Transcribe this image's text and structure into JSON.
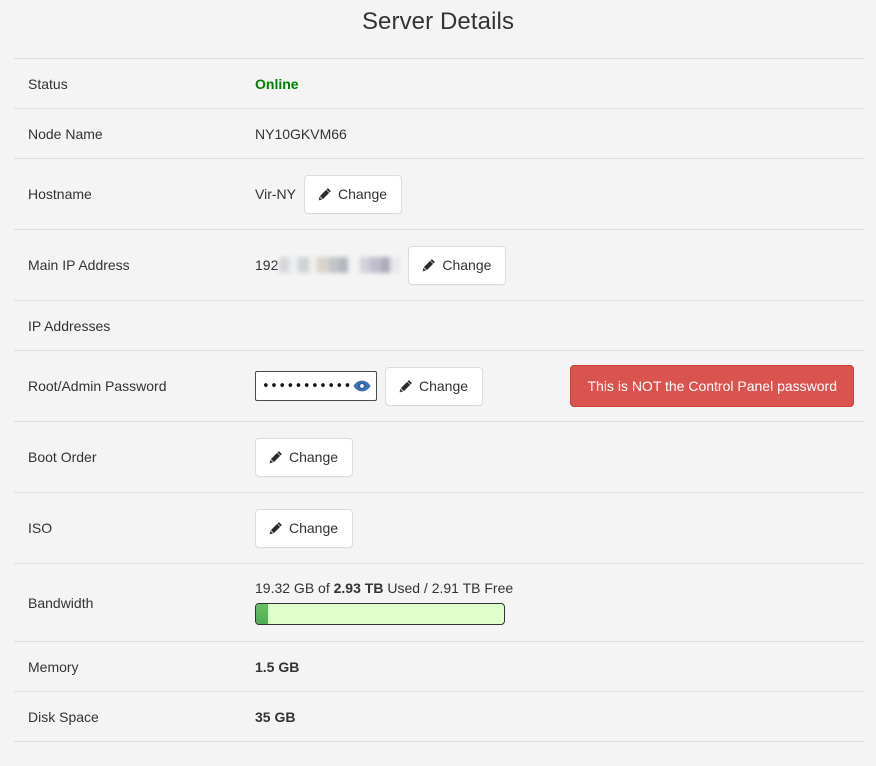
{
  "page": {
    "title": "Server Details",
    "background_color": "#f4f4f4",
    "divider_color": "#dedede"
  },
  "rows": {
    "status": {
      "label": "Status",
      "value": "Online",
      "value_color": "#008000"
    },
    "node_name": {
      "label": "Node Name",
      "value": "NY10GKVM66"
    },
    "hostname": {
      "label": "Hostname",
      "value": "Vir-NY",
      "button_label": "Change"
    },
    "main_ip": {
      "label": "Main IP Address",
      "value_prefix": "192",
      "value_redacted": true,
      "button_label": "Change"
    },
    "ip_addresses": {
      "label": "IP Addresses",
      "value": ""
    },
    "root_password": {
      "label": "Root/Admin Password",
      "masked_value": "•••••••••••••••",
      "reveal_icon": "eye-icon",
      "reveal_icon_color": "#3a72b8",
      "button_label": "Change",
      "warning_label": "This is NOT the Control Panel password",
      "warning_color": "#d9534f"
    },
    "boot_order": {
      "label": "Boot Order",
      "button_label": "Change"
    },
    "iso": {
      "label": "ISO",
      "button_label": "Change"
    },
    "bandwidth": {
      "label": "Bandwidth",
      "used": "19.32 GB",
      "of_text": "of",
      "total": "2.93 TB",
      "used_text": "Used /",
      "free": "2.91 TB Free",
      "summary": "19.32 GB of 2.93 TB Used / 2.91 TB Free",
      "percent_used": 5,
      "bar_fill_color": "#5cb85c",
      "bar_track_color": "#ddffcc"
    },
    "memory": {
      "label": "Memory",
      "value": "1.5 GB"
    },
    "disk_space": {
      "label": "Disk Space",
      "value": "35 GB"
    }
  }
}
